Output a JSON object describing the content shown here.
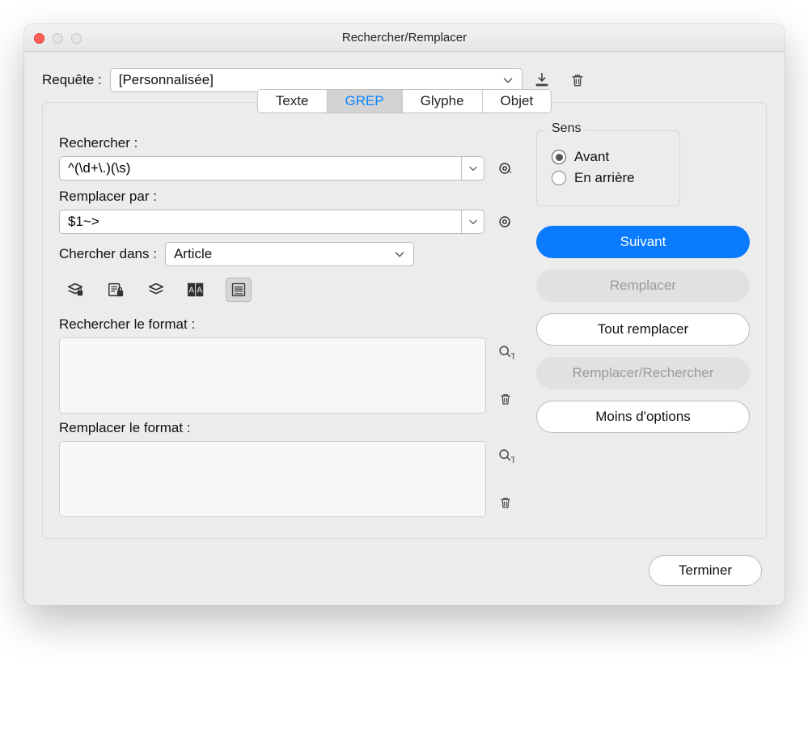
{
  "window": {
    "title": "Rechercher/Remplacer"
  },
  "query": {
    "label": "Requête :",
    "value": "[Personnalisée]"
  },
  "tabs": {
    "text": "Texte",
    "grep": "GREP",
    "glyph": "Glyphe",
    "object": "Objet",
    "active": "grep"
  },
  "find": {
    "label": "Rechercher :",
    "value": "^(\\d+\\.)(\\s)"
  },
  "replace": {
    "label": "Remplacer par :",
    "value": "$1~>"
  },
  "searchIn": {
    "label": "Chercher dans :",
    "value": "Article"
  },
  "findFormat": {
    "label": "Rechercher le format :"
  },
  "replaceFormat": {
    "label": "Remplacer le format :"
  },
  "direction": {
    "title": "Sens",
    "forward": "Avant",
    "backward": "En arrière",
    "selected": "forward"
  },
  "buttons": {
    "next": "Suivant",
    "replace": "Remplacer",
    "replaceAll": "Tout remplacer",
    "replaceFind": "Remplacer/Rechercher",
    "lessOptions": "Moins d'options",
    "done": "Terminer"
  }
}
